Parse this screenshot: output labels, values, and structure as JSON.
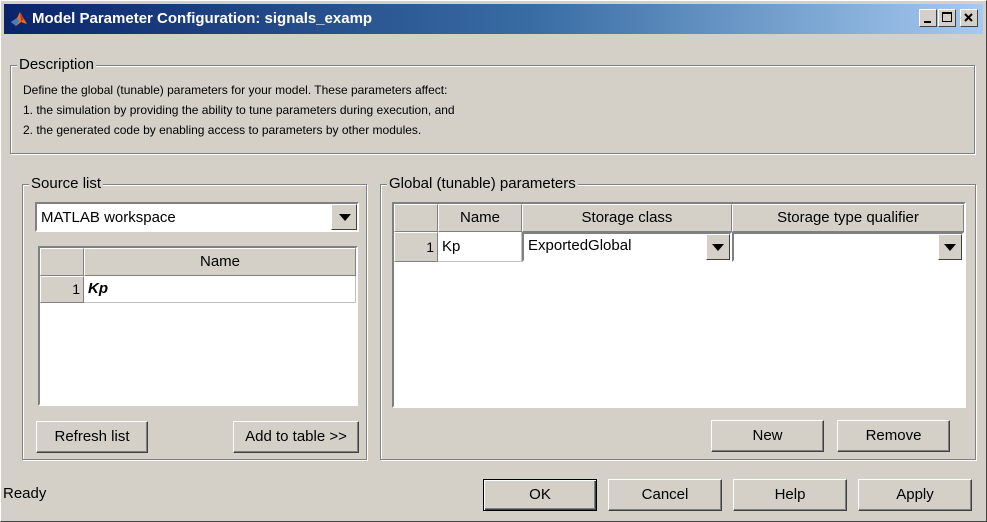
{
  "window": {
    "title": "Model Parameter Configuration: signals_examp",
    "app_icon": "matlab-icon"
  },
  "description": {
    "legend": "Description",
    "lines": [
      "Define the global (tunable) parameters for your model. These parameters affect:",
      "1. the simulation by providing the ability to tune parameters during execution, and",
      "2. the generated code by enabling access to parameters by other modules."
    ]
  },
  "source_list": {
    "legend": "Source list",
    "source_value": "MATLAB workspace",
    "column_name": "Name",
    "rows": [
      {
        "index": "1",
        "name": "Kp"
      }
    ],
    "refresh_label": "Refresh list",
    "add_label": "Add to table >>"
  },
  "global_params": {
    "legend": "Global (tunable) parameters",
    "columns": [
      "Name",
      "Storage class",
      "Storage type qualifier"
    ],
    "rows": [
      {
        "index": "1",
        "name": "Kp",
        "storage_class": "ExportedGlobal",
        "qualifier": ""
      }
    ],
    "new_label": "New",
    "remove_label": "Remove"
  },
  "footer": {
    "status": "Ready",
    "ok_label": "OK",
    "cancel_label": "Cancel",
    "help_label": "Help",
    "apply_label": "Apply"
  }
}
